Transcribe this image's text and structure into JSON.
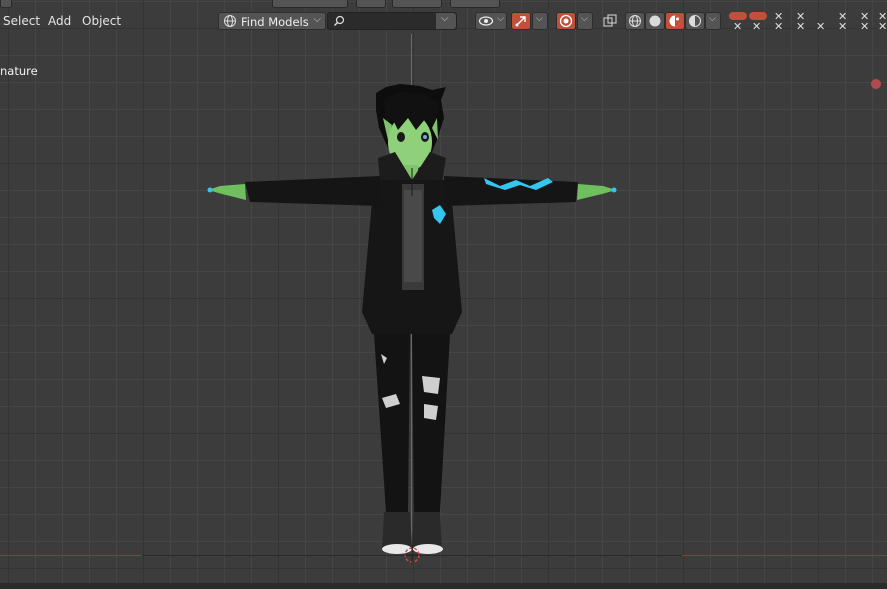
{
  "header": {
    "menus": [
      "Select",
      "Add",
      "Object"
    ],
    "find_models": "Find Models",
    "search_placeholder": ""
  },
  "viewport": {
    "armature_label": "nature"
  },
  "colors": {
    "accent": "#c0503a",
    "background": "#3c3c3c",
    "x_axis": "#8a3b3b",
    "z_axis": "#4a6ea0",
    "glow": "#35c6f0"
  },
  "icons": [
    "globe-icon",
    "search-icon",
    "eye-icon",
    "arrow-icon",
    "overlay-icon",
    "xray-icon",
    "wireframe-icon",
    "solid-icon",
    "material-icon",
    "rendered-icon",
    "close-icon"
  ]
}
